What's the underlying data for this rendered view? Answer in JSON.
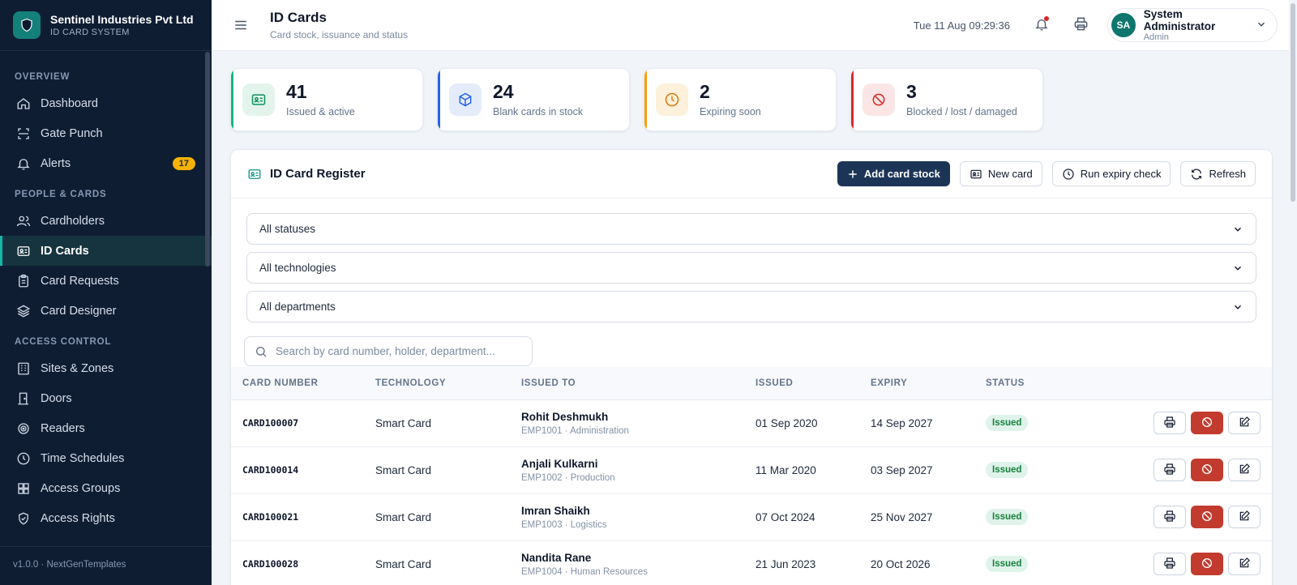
{
  "brand": {
    "name": "Sentinel Industries Pvt Ltd",
    "subtitle": "ID CARD SYSTEM"
  },
  "sidebar": {
    "sections": [
      {
        "label": "OVERVIEW"
      },
      {
        "label": "PEOPLE & CARDS"
      },
      {
        "label": "ACCESS CONTROL"
      }
    ],
    "items": [
      {
        "label": "Dashboard",
        "icon": "home-icon"
      },
      {
        "label": "Gate Punch",
        "icon": "scan-icon"
      },
      {
        "label": "Alerts",
        "icon": "bell-icon",
        "badge": "17"
      },
      {
        "label": "Cardholders",
        "icon": "users-icon"
      },
      {
        "label": "ID Cards",
        "icon": "id-card-icon",
        "active": true
      },
      {
        "label": "Card Requests",
        "icon": "clipboard-icon"
      },
      {
        "label": "Card Designer",
        "icon": "layers-icon"
      },
      {
        "label": "Sites & Zones",
        "icon": "building-icon"
      },
      {
        "label": "Doors",
        "icon": "door-icon"
      },
      {
        "label": "Readers",
        "icon": "reader-icon"
      },
      {
        "label": "Time Schedules",
        "icon": "clock-icon"
      },
      {
        "label": "Access Groups",
        "icon": "grid-icon"
      },
      {
        "label": "Access Rights",
        "icon": "shield-icon"
      }
    ],
    "footer": "v1.0.0 · NextGenTemplates"
  },
  "header": {
    "title": "ID Cards",
    "subtitle": "Card stock, issuance and status",
    "datetime": "Tue 11 Aug 09:29:36",
    "user": {
      "initials": "SA",
      "name": "System Administrator",
      "role": "Admin"
    }
  },
  "stats": [
    {
      "value": "41",
      "label": "Issued & active",
      "color": "#10b981"
    },
    {
      "value": "24",
      "label": "Blank cards in stock",
      "color": "#2563eb"
    },
    {
      "value": "2",
      "label": "Expiring soon",
      "color": "#f59e0b"
    },
    {
      "value": "3",
      "label": "Blocked / lost / damaged",
      "color": "#dc2626"
    }
  ],
  "register": {
    "title": "ID Card Register",
    "actions": {
      "add_stock": "Add card stock",
      "new_card": "New card",
      "expiry_check": "Run expiry check",
      "refresh": "Refresh"
    },
    "filters": {
      "status": "All statuses",
      "technology": "All technologies",
      "department": "All departments"
    },
    "search_placeholder": "Search by card number, holder, department...",
    "columns": [
      "CARD NUMBER",
      "TECHNOLOGY",
      "ISSUED TO",
      "ISSUED",
      "EXPIRY",
      "STATUS"
    ],
    "rows": [
      {
        "card": "CARD100007",
        "tech": "Smart Card",
        "name": "Rohit Deshmukh",
        "sub": "EMP1001 · Administration",
        "issued": "01 Sep 2020",
        "expiry": "14 Sep 2027",
        "status": "Issued"
      },
      {
        "card": "CARD100014",
        "tech": "Smart Card",
        "name": "Anjali Kulkarni",
        "sub": "EMP1002 · Production",
        "issued": "11 Mar 2020",
        "expiry": "03 Sep 2027",
        "status": "Issued"
      },
      {
        "card": "CARD100021",
        "tech": "Smart Card",
        "name": "Imran Shaikh",
        "sub": "EMP1003 · Logistics",
        "issued": "07 Oct 2024",
        "expiry": "25 Nov 2027",
        "status": "Issued"
      },
      {
        "card": "CARD100028",
        "tech": "Smart Card",
        "name": "Nandita Rane",
        "sub": "EMP1004 · Human Resources",
        "issued": "21 Jun 2023",
        "expiry": "20 Oct 2026",
        "status": "Issued"
      }
    ]
  },
  "colors": {
    "sidebar_bg": "#0f1d33",
    "accent": "#14b8a6",
    "primary_btn": "#1c3557",
    "danger": "#c23b2e",
    "status_issued": "#15803d"
  }
}
